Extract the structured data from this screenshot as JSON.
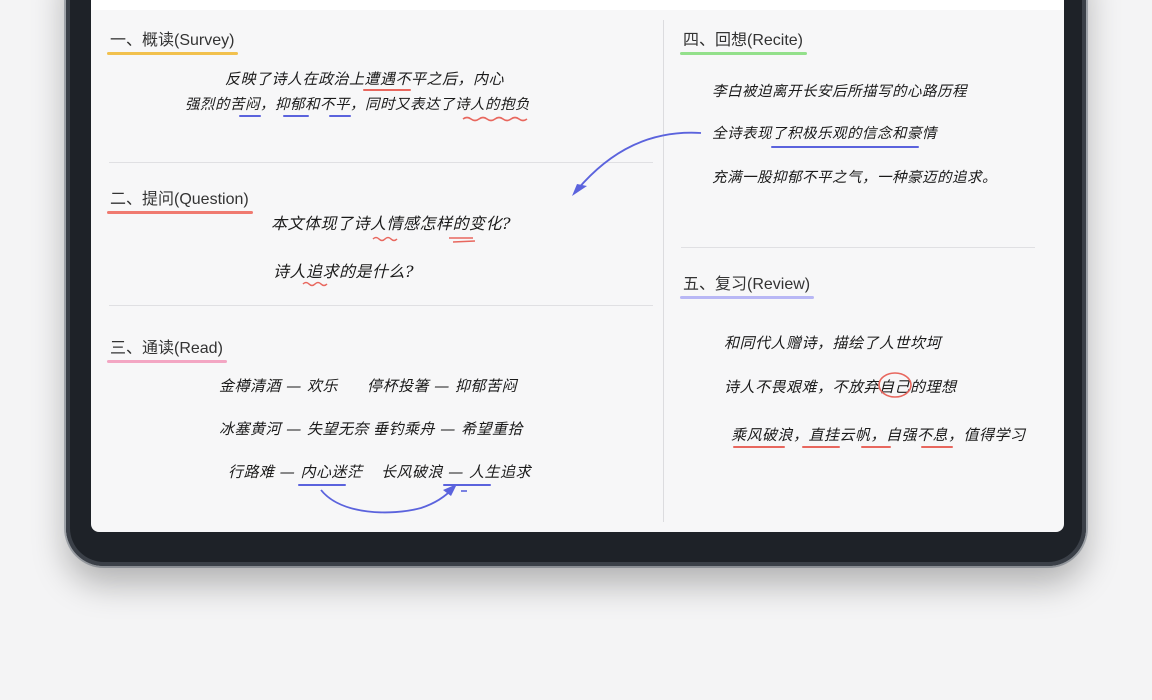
{
  "colors": {
    "yellow": "#f2c14e",
    "red": "#f07a70",
    "pink": "#f3a6c3",
    "green": "#93e08b",
    "purple": "#b8b7f5",
    "blue_ink": "#5b63dd",
    "red_ink": "#e8675e"
  },
  "sections": {
    "survey": {
      "title": "一、概读(Survey)",
      "lines": [
        "反映了诗人在政治上遭遇不平之后，内心",
        "强烈的苦闷，抑郁和不平，同时又表达了诗人的抱负"
      ]
    },
    "question": {
      "title": "二、提问(Question)",
      "lines": [
        "本文体现了诗人情感怎样的变化?",
        "诗人追求的是什么?"
      ]
    },
    "read": {
      "title": "三、通读(Read)",
      "pairs": [
        [
          "金樽清酒 — 欢乐",
          "停杯投箸 — 抑郁苦闷"
        ],
        [
          "冰塞黄河 — 失望无奈",
          "垂钓乘舟 — 希望重拾"
        ],
        [
          "行路难 — 内心迷茫",
          "长风破浪 — 人生追求"
        ]
      ]
    },
    "recite": {
      "title": "四、回想(Recite)",
      "lines": [
        "李白被迫离开长安后所描写的心路历程",
        "全诗表现了积极乐观的信念和豪情",
        "充满一股抑郁不平之气，一种豪迈的追求。"
      ]
    },
    "review": {
      "title": "五、复习(Review)",
      "lines": [
        "和同代人赠诗，描绘了人世坎坷",
        "诗人不畏艰难，不放弃自己的理想",
        "乘风破浪，直挂云帆，自强不息，值得学习"
      ]
    }
  }
}
